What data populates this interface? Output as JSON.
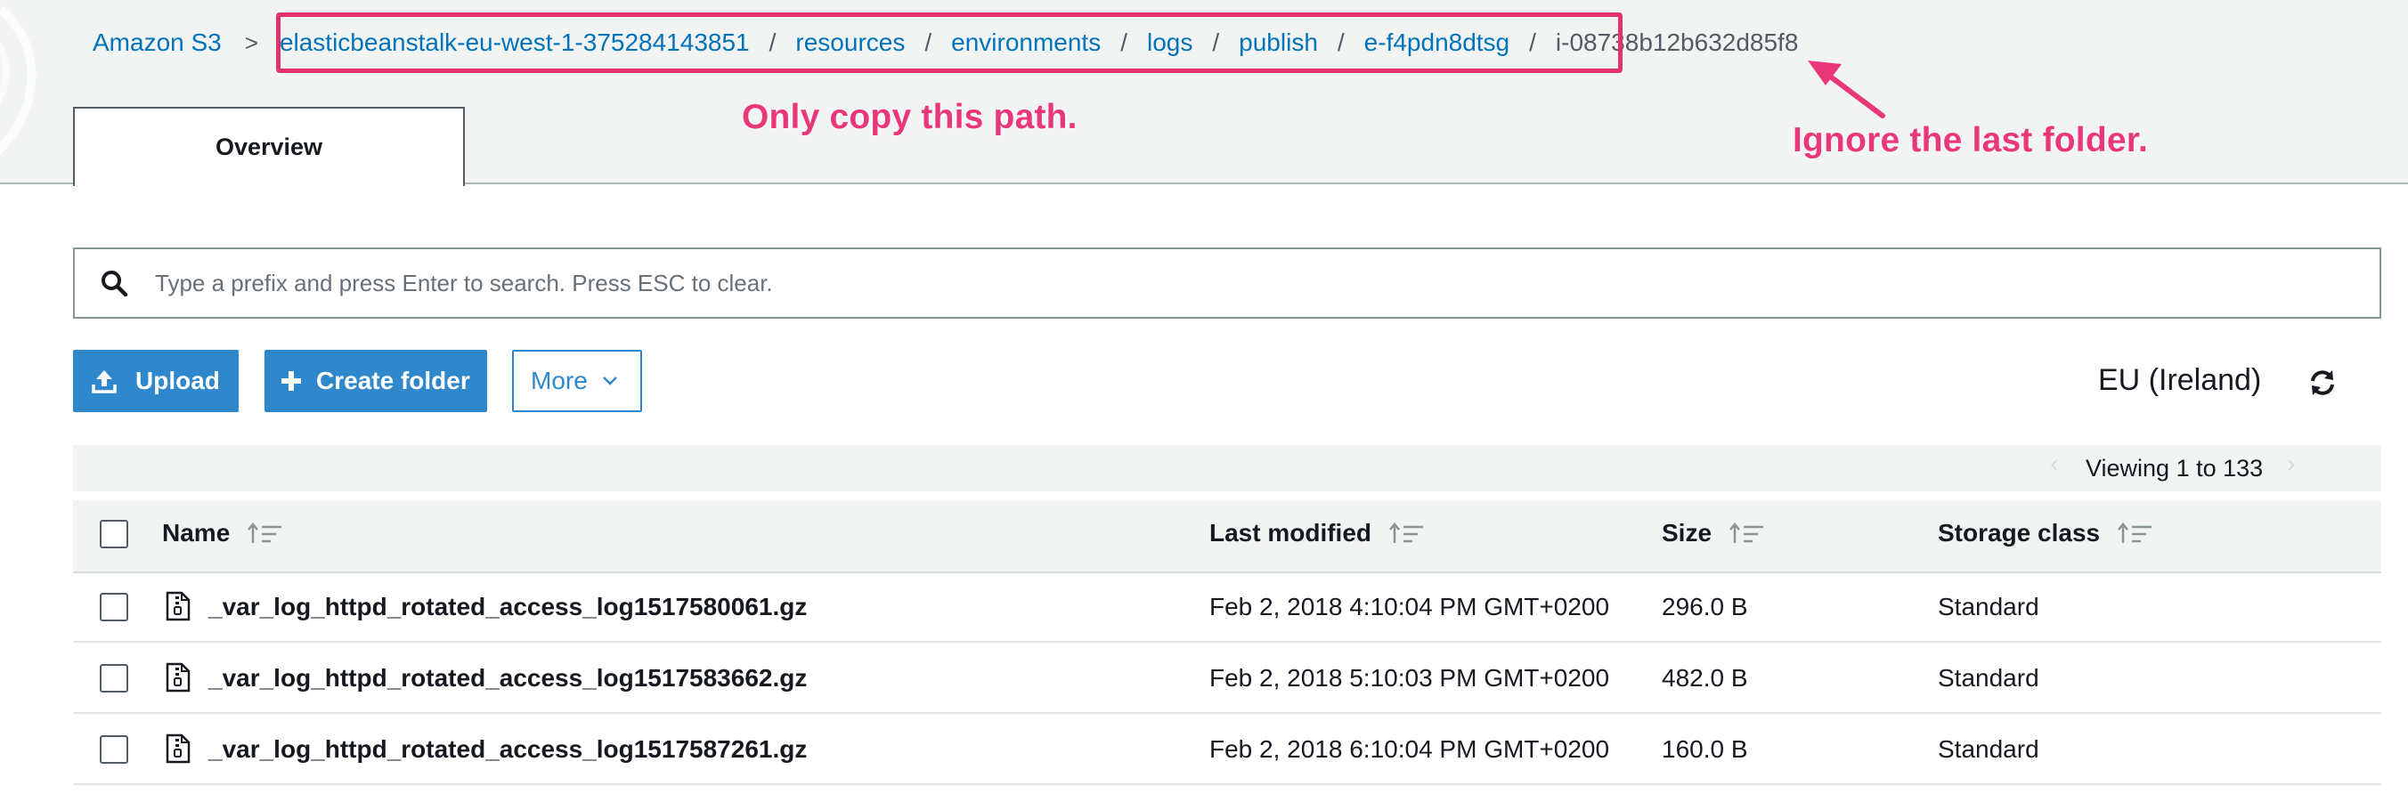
{
  "breadcrumb": {
    "root": "Amazon S3",
    "root_sep": ">",
    "separator": "/",
    "links": [
      "elasticbeanstalk-eu-west-1-375284143851",
      "resources",
      "environments",
      "logs",
      "publish",
      "e-f4pdn8dtsg"
    ],
    "current": "i-08738b12b632d85f8"
  },
  "annotations": {
    "copy_path": "Only copy this path.",
    "ignore_last": "Ignore the last folder.",
    "color": "#e8387a"
  },
  "tabs": {
    "overview": "Overview"
  },
  "search": {
    "placeholder": "Type a prefix and press Enter to search. Press ESC to clear.",
    "value": "",
    "icon": "search-icon"
  },
  "toolbar": {
    "upload": "Upload",
    "create_folder": "Create folder",
    "more": "More",
    "region": "EU (Ireland)",
    "refresh_icon": "refresh-icon"
  },
  "pagination": {
    "text": "Viewing 1 to 133",
    "prev": "‹",
    "next": "›"
  },
  "table": {
    "columns": [
      "Name",
      "Last modified",
      "Size",
      "Storage class"
    ],
    "rows": [
      {
        "name": "_var_log_httpd_rotated_access_log1517580061.gz",
        "modified": "Feb 2, 2018 4:10:04 PM GMT+0200",
        "size": "296.0 B",
        "storage": "Standard"
      },
      {
        "name": "_var_log_httpd_rotated_access_log1517583662.gz",
        "modified": "Feb 2, 2018 5:10:03 PM GMT+0200",
        "size": "482.0 B",
        "storage": "Standard"
      },
      {
        "name": "_var_log_httpd_rotated_access_log1517587261.gz",
        "modified": "Feb 2, 2018 6:10:04 PM GMT+0200",
        "size": "160.0 B",
        "storage": "Standard"
      }
    ]
  },
  "colors": {
    "link": "#0073bb",
    "primary_button": "#2e88cb",
    "annotation": "#e8387a"
  }
}
